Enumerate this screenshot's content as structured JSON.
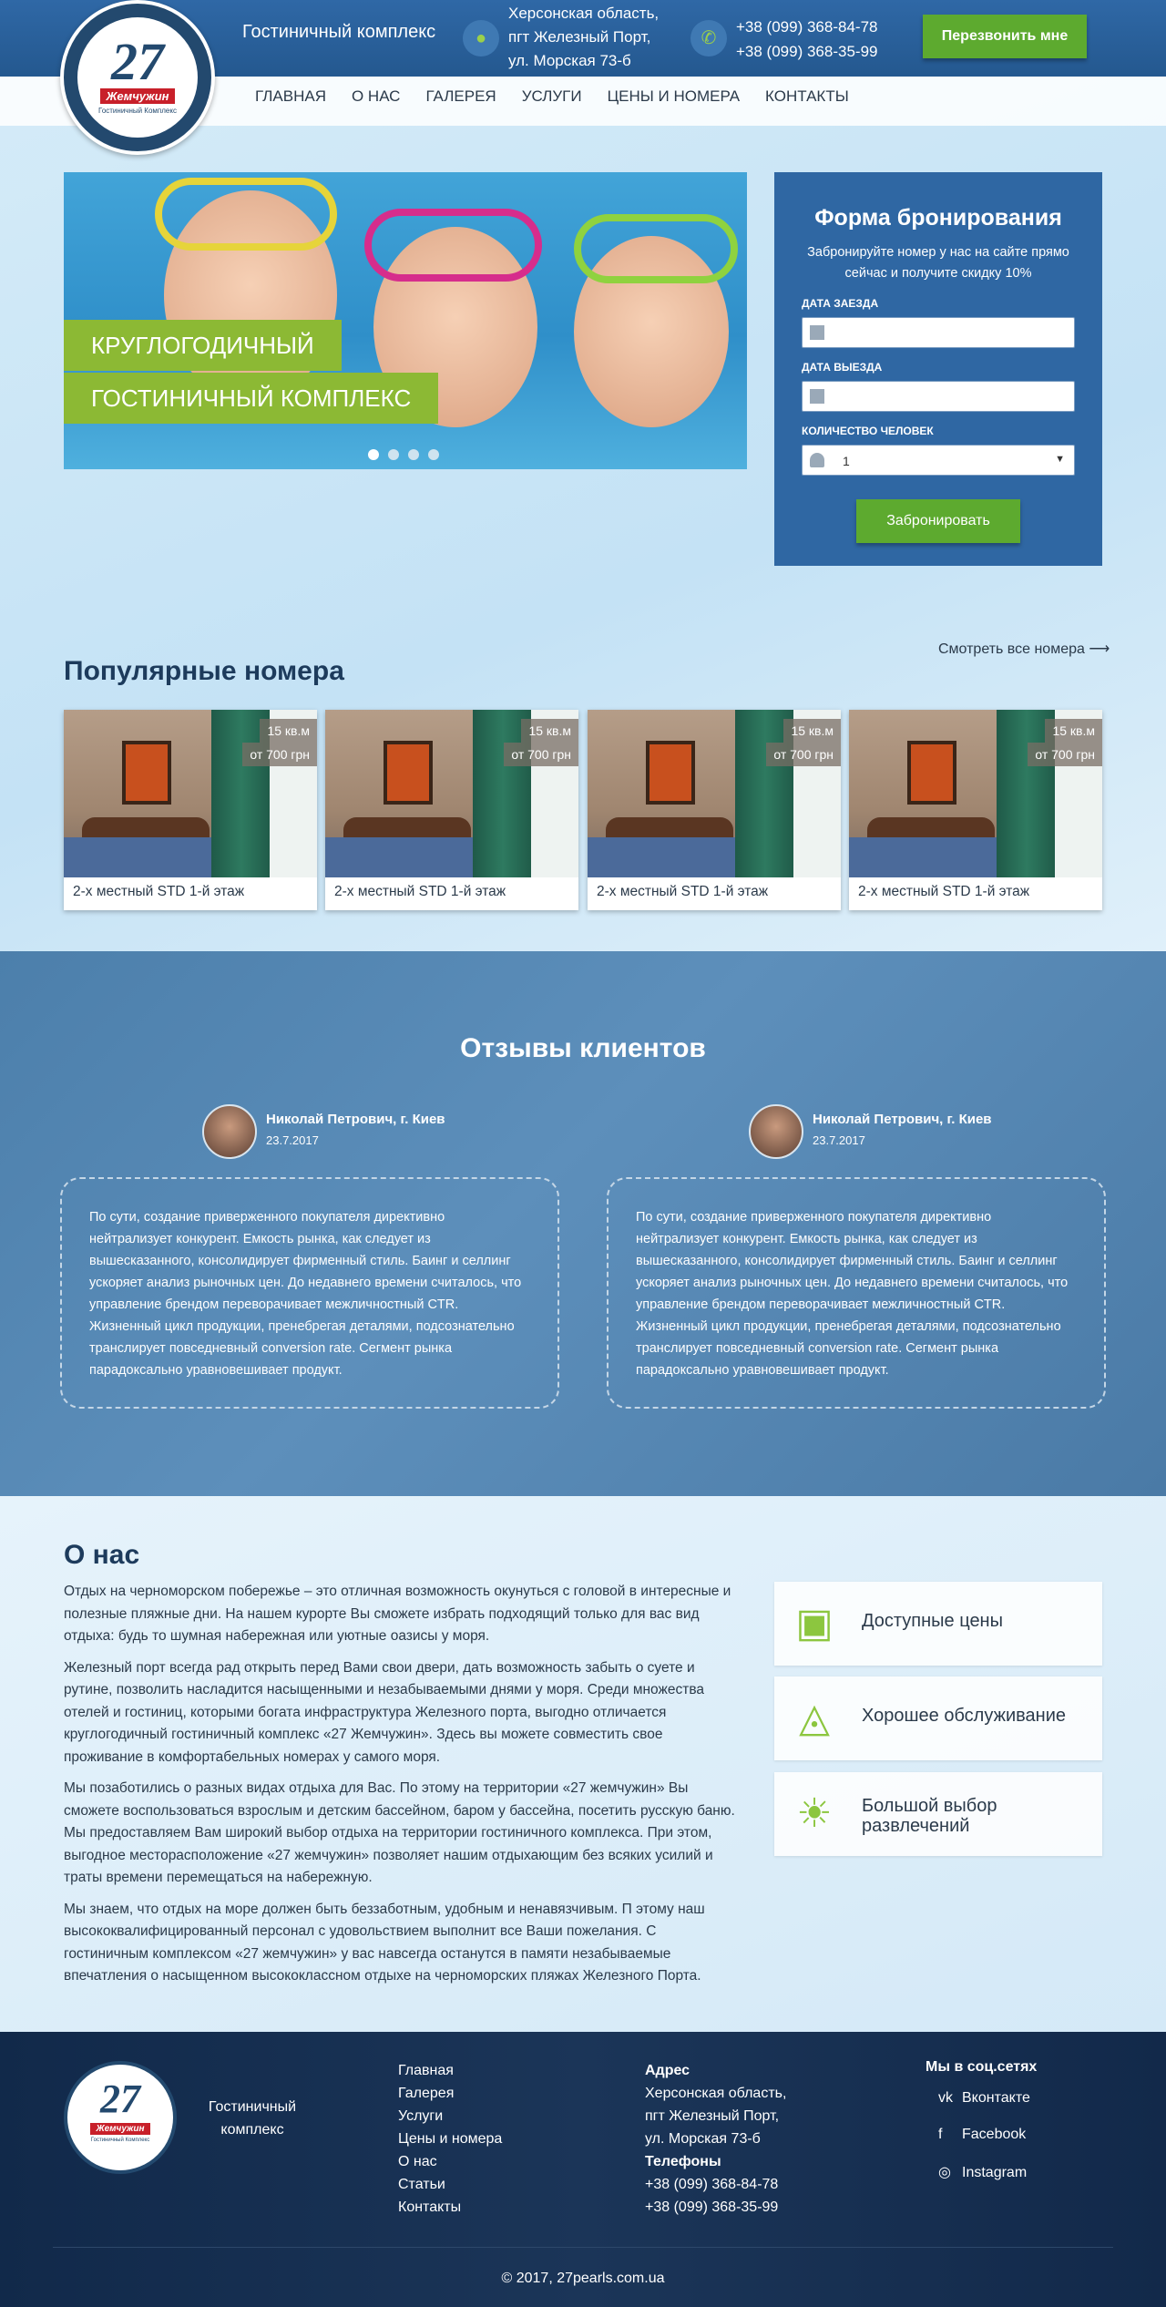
{
  "header": {
    "logo_number": "27",
    "logo_name": "Жемчужин",
    "logo_sub": "Гостиничный Комплекс",
    "brand": "Гостиничный комплекс",
    "address_lines": [
      "Херсонская область,",
      "пгт Железный Порт,",
      "ул. Морская 73-б"
    ],
    "phones": [
      "+38 (099) 368-84-78",
      "+38 (099) 368-35-99"
    ],
    "callback_label": "Перезвонить мне"
  },
  "menu": [
    "Главная",
    "О нас",
    "Галерея",
    "Услуги",
    "Цены и номера",
    "Контакты"
  ],
  "hero": {
    "line1": "КРУГЛОГОДИЧНЫЙ",
    "line2": "ГОСТИНИЧНЫЙ КОМПЛЕКС",
    "slides": 4,
    "active_slide": 1
  },
  "booking": {
    "title": "Форма бронирования",
    "subtitle": "Забронируйте номер у нас на сайте прямо сейчас и получите скидку 10%",
    "checkin_label": "Дата заезда",
    "checkout_label": "Дата выезда",
    "guests_label": "Количество человек",
    "guests_value": "1",
    "submit_label": "Забронировать"
  },
  "popular": {
    "title": "Популярные номера",
    "see_all": "Смотреть все номера ⟶",
    "rooms": [
      {
        "area": "15 кв.м",
        "price": "от 700 грн",
        "name": "2-х местный STD 1-й этаж"
      },
      {
        "area": "15 кв.м",
        "price": "от 700 грн",
        "name": "2-х местный STD 1-й этаж"
      },
      {
        "area": "15 кв.м",
        "price": "от 700 грн",
        "name": "2-х местный STD 1-й этаж"
      },
      {
        "area": "15 кв.м",
        "price": "от 700 грн",
        "name": "2-х местный STD 1-й этаж"
      }
    ]
  },
  "reviews": {
    "title": "Отзывы клиентов",
    "items": [
      {
        "name": "Николай Петрович, г. Киев",
        "date": "23.7.2017",
        "text": "По сути, создание приверженного покупателя директивно нейтрализует конкурент. Емкость рынка, как следует из вышесказанного, консолидирует фирменный стиль. Баинг и селлинг ускоряет анализ рыночных цен. До недавнего времени считалось, что управление брендом переворачивает межличностный CTR. Жизненный цикл продукции, пренебрегая деталями, подсознательно транслирует повседневный conversion rate. Сегмент рынка парадоксально уравновешивает продукт."
      },
      {
        "name": "Николай Петрович, г. Киев",
        "date": "23.7.2017",
        "text": "По сути, создание приверженного покупателя директивно нейтрализует конкурент. Емкость рынка, как следует из вышесказанного, консолидирует фирменный стиль. Баинг и селлинг ускоряет анализ рыночных цен. До недавнего времени считалось, что управление брендом переворачивает межличностный CTR. Жизненный цикл продукции, пренебрегая деталями, подсознательно транслирует повседневный conversion rate. Сегмент рынка парадоксально уравновешивает продукт."
      }
    ]
  },
  "about": {
    "title": "О нас",
    "paragraphs": [
      "Отдых на черноморском побережье – это отличная возможность окунуться с головой в интересные и полезные пляжные дни. На нашем курорте Вы сможете избрать подходящий только для вас вид отдыха: будь то шумная набережная или уютные оазисы у моря.",
      "Железный порт всегда рад открыть перед Вами свои двери, дать возможность забыть о суете и рутине, позволить насладится насыщенными и незабываемыми днями у моря. Среди множества отелей и гостиниц, которыми богата инфраструктура Железного порта, выгодно отличается круглогодичный гостиничный комплекс «27 Жемчужин». Здесь вы можете совместить свое проживание в комфортабельных номерах у самого моря.",
      "Мы позаботились о разных видах отдыха для Вас. По этому на территории «27 жемчужин» Вы сможете воспользоваться взрослым и детским бассейном, баром у бассейна, посетить русскую баню. Мы предоставляем Вам широкий выбор отдыха на территории гостиничного комплекса. При этом, выгодное месторасположение «27 жемчужин» позволяет нашим отдыхающим без всяких усилий и траты времени перемещаться на набережную.",
      "Мы знаем, что отдых на море должен быть беззаботным, удобным и ненавязчивым. П этому наш высококвалифицированный персонал с удовольствием выполнит все Ваши пожелания. С гостиничным комплексом «27 жемчужин» у вас навсегда останутся в памяти незабываемые впечатления о насыщенном высококлассном отдыхе на черноморских пляжах Железного Порта."
    ],
    "features": [
      {
        "icon": "wallet-icon",
        "label": "Доступные цены"
      },
      {
        "icon": "service-tray-icon",
        "label": "Хорошее обслуживание"
      },
      {
        "icon": "sunbed-icon",
        "label": "Большой выбор развлечений"
      }
    ]
  },
  "footer": {
    "brand": "Гостиничный комплекс",
    "nav": [
      "Главная",
      "Галерея",
      "Услуги",
      "Цены и номера",
      "О нас",
      "Статьи",
      "Контакты"
    ],
    "address_title": "Адрес",
    "address_lines": [
      "Херсонская область,",
      "пгт Железный Порт,",
      "ул. Морская 73-б"
    ],
    "phones_title": "Телефоны",
    "phones": [
      "+38 (099) 368-84-78",
      "+38 (099) 368-35-99"
    ],
    "social_title": "Мы в соц.сетях",
    "social": [
      {
        "icon": "vk-icon",
        "label": "Вконтакте"
      },
      {
        "icon": "facebook-icon",
        "label": "Facebook"
      },
      {
        "icon": "instagram-icon",
        "label": "Instagram"
      }
    ],
    "copyright": "© 2017, 27pearls.com.ua"
  },
  "colors": {
    "header_blue": "#2f68a6",
    "accent_green": "#5daa2f",
    "footer": "#1b3558",
    "reviews_bg": "#5a8bb7"
  }
}
